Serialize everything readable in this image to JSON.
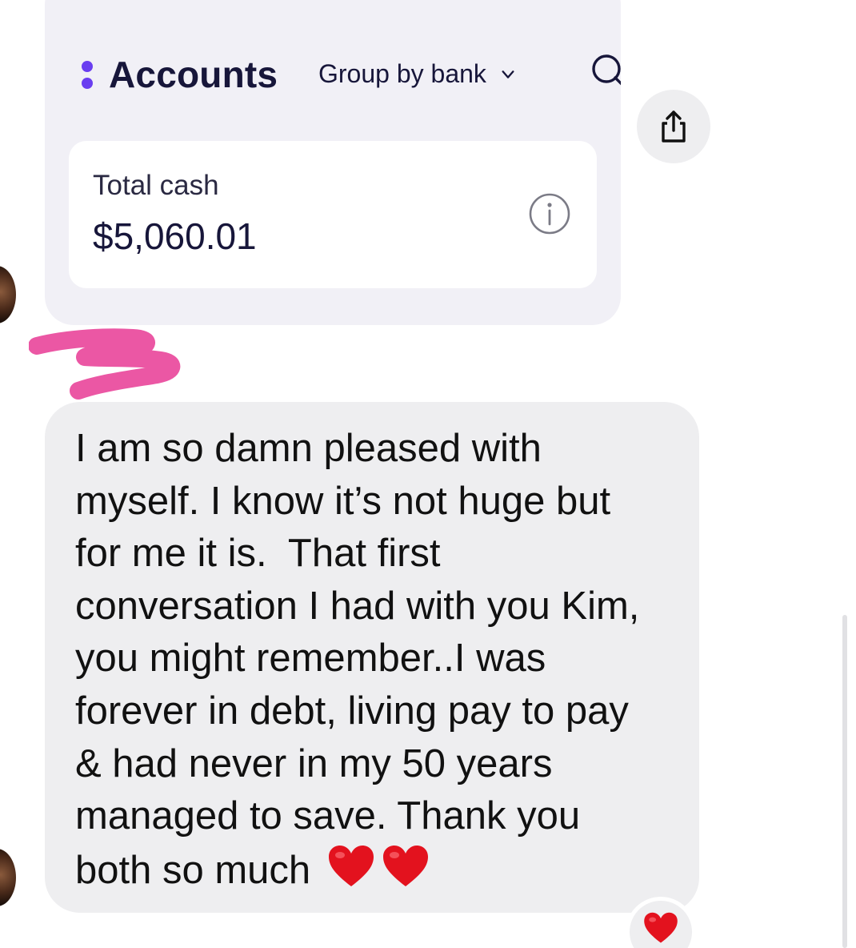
{
  "shared_screenshot": {
    "header": {
      "title": "Accounts",
      "group_by_label": "Group by bank"
    },
    "total_cash": {
      "label": "Total cash",
      "value": "$5,060.01"
    },
    "icons": [
      "more-dots-icon",
      "chevron-down-icon",
      "search-icon",
      "info-icon"
    ]
  },
  "message": {
    "text": "I am so damn pleased with\nmyself. I know it’s not huge but\nfor me it is.  That first\nconversation I had with you Kim,\nyou might remember..I was\nforever in debt, living pay to pay\n& had never in my 50 years\nmanaged to save. Thank you\nboth so much ",
    "emoji": [
      "red-heart",
      "red-heart"
    ]
  },
  "reaction": {
    "emoji": "red-heart"
  },
  "actions": {
    "share_icon": "share-icon"
  },
  "colors": {
    "accent_purple": "#6a3ef0",
    "bubble_gray": "#eeeef0",
    "heart_red": "#e3121e",
    "scribble_pink": "#e9459a"
  }
}
